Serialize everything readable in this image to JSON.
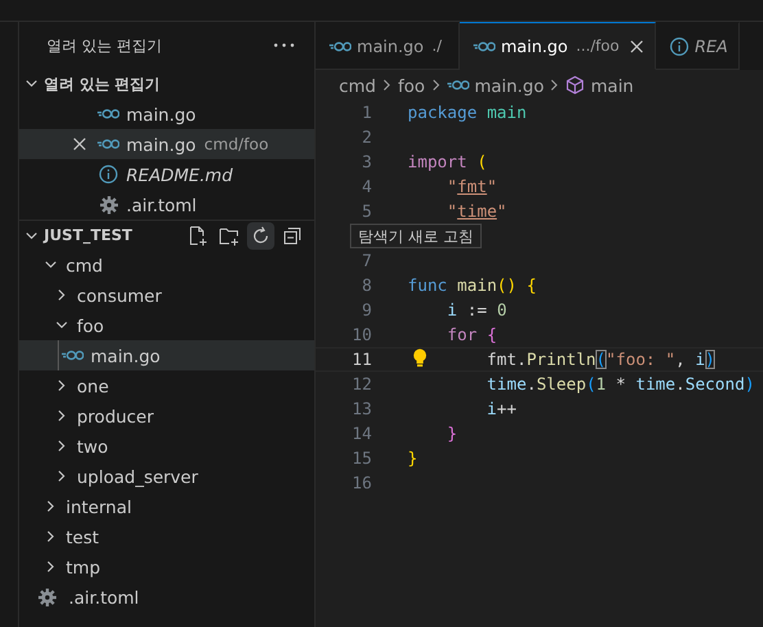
{
  "sidebar": {
    "title": "열려 있는 편집기"
  },
  "open_editors": {
    "title": "열려 있는 편집기",
    "expanded": true,
    "items": [
      {
        "name": "main.go",
        "kind": "go",
        "preview": false,
        "selected": false,
        "close": false
      },
      {
        "name": "main.go",
        "description": "cmd/foo",
        "kind": "go",
        "preview": false,
        "selected": true,
        "close": true
      },
      {
        "name": "README.md",
        "kind": "info",
        "preview": true,
        "selected": false,
        "close": false
      },
      {
        "name": ".air.toml",
        "kind": "gear",
        "preview": false,
        "selected": false,
        "close": false
      }
    ]
  },
  "explorer": {
    "title": "JUST_TEST",
    "expanded": true,
    "tooltip": "탐색기 새로 고침",
    "actions": [
      {
        "kind": "new-file",
        "hovered": false
      },
      {
        "kind": "new-folder",
        "hovered": false
      },
      {
        "kind": "refresh",
        "hovered": true
      },
      {
        "kind": "collapse",
        "hovered": false
      }
    ],
    "items": [
      {
        "name": "cmd",
        "kind": "folder",
        "expanded": true,
        "selected": false,
        "children": [
          {
            "name": "consumer",
            "kind": "folder",
            "expanded": false,
            "selected": false
          },
          {
            "name": "foo",
            "kind": "folder",
            "expanded": true,
            "selected": false,
            "children": [
              {
                "name": "main.go",
                "kind": "go",
                "selected": true
              }
            ]
          },
          {
            "name": "one",
            "kind": "folder",
            "expanded": false,
            "selected": false
          },
          {
            "name": "producer",
            "kind": "folder",
            "expanded": false,
            "selected": false
          },
          {
            "name": "two",
            "kind": "folder",
            "expanded": false,
            "selected": false
          },
          {
            "name": "upload_server",
            "kind": "folder",
            "expanded": false,
            "selected": false
          }
        ]
      },
      {
        "name": "internal",
        "kind": "folder",
        "expanded": false,
        "selected": false
      },
      {
        "name": "test",
        "kind": "folder",
        "expanded": false,
        "selected": false
      },
      {
        "name": "tmp",
        "kind": "folder",
        "expanded": false,
        "selected": false
      },
      {
        "name": ".air.toml",
        "kind": "gear",
        "selected": false
      }
    ]
  },
  "editor": {
    "tabs": [
      {
        "label": "main.go",
        "description": "./",
        "kind": "go",
        "selected": false,
        "preview": false,
        "close": false
      },
      {
        "label": "main.go",
        "description": ".../foo",
        "kind": "go",
        "selected": true,
        "preview": false,
        "close": true
      },
      {
        "label": "REA",
        "kind": "info",
        "selected": false,
        "preview": true,
        "close": false
      }
    ],
    "breadcrumbs": [
      {
        "label": "cmd",
        "kind": "folder"
      },
      {
        "label": "foo",
        "kind": "folder"
      },
      {
        "label": "main.go",
        "kind": "go"
      },
      {
        "label": "main",
        "kind": "symbol"
      }
    ],
    "lines": [
      {
        "number": "1",
        "current": false,
        "lightbulb": false,
        "tokens": [
          {
            "kind": "kw",
            "text": "package"
          },
          {
            "kind": "pkg",
            "text": " main"
          }
        ]
      },
      {
        "number": "2",
        "current": false,
        "lightbulb": false
      },
      {
        "number": "3",
        "current": false,
        "lightbulb": false,
        "tokens": [
          {
            "kind": "ctrl",
            "text": "import"
          },
          {
            "kind": "b1",
            "text": " ("
          }
        ]
      },
      {
        "number": "4",
        "current": false,
        "lightbulb": false,
        "tokens": [
          {
            "kind": "str",
            "text": "    \""
          },
          {
            "kind": "link",
            "text": "fmt"
          },
          {
            "kind": "str",
            "text": "\""
          }
        ]
      },
      {
        "number": "5",
        "current": false,
        "lightbulb": false,
        "tokens": [
          {
            "kind": "str",
            "text": "    \""
          },
          {
            "kind": "link",
            "text": "time"
          },
          {
            "kind": "str",
            "text": "\""
          }
        ]
      },
      {
        "number": "7",
        "current": false,
        "lightbulb": false
      },
      {
        "number": "8",
        "current": false,
        "lightbulb": false,
        "tokens": [
          {
            "kind": "kw",
            "text": "func"
          },
          {
            "kind": "fn",
            "text": " main"
          },
          {
            "kind": "b1",
            "text": "() {"
          }
        ]
      },
      {
        "number": "9",
        "current": false,
        "lightbulb": false,
        "tokens": [
          {
            "kind": "var",
            "text": "    i"
          },
          {
            "kind": "plain",
            "text": " := "
          },
          {
            "kind": "num",
            "text": "0"
          }
        ]
      },
      {
        "number": "10",
        "current": false,
        "lightbulb": false,
        "tokens": [
          {
            "kind": "ctrl",
            "text": "    for"
          },
          {
            "kind": "b2",
            "text": " {"
          }
        ]
      },
      {
        "number": "11",
        "current": true,
        "lightbulb": true,
        "tokens": [
          {
            "kind": "plain",
            "text": "        fmt."
          },
          {
            "kind": "fn",
            "text": "Println"
          },
          {
            "kind": "b3m",
            "text": "("
          },
          {
            "kind": "str",
            "text": "\"foo: \""
          },
          {
            "kind": "plain",
            "text": ","
          },
          {
            "kind": "var",
            "text": " i"
          },
          {
            "kind": "b3m",
            "text": ")"
          }
        ]
      },
      {
        "number": "12",
        "current": false,
        "lightbulb": false,
        "tokens": [
          {
            "kind": "var",
            "text": "        time"
          },
          {
            "kind": "plain",
            "text": "."
          },
          {
            "kind": "fn",
            "text": "Sleep"
          },
          {
            "kind": "b3",
            "text": "("
          },
          {
            "kind": "num",
            "text": "1"
          },
          {
            "kind": "plain",
            "text": " * "
          },
          {
            "kind": "var",
            "text": "time"
          },
          {
            "kind": "plain",
            "text": "."
          },
          {
            "kind": "var",
            "text": "Second"
          },
          {
            "kind": "b3",
            "text": ")"
          }
        ]
      },
      {
        "number": "13",
        "current": false,
        "lightbulb": false,
        "tokens": [
          {
            "kind": "var",
            "text": "        i"
          },
          {
            "kind": "plain",
            "text": "++"
          }
        ]
      },
      {
        "number": "14",
        "current": false,
        "lightbulb": false,
        "tokens": [
          {
            "kind": "b2",
            "text": "    }"
          }
        ]
      },
      {
        "number": "15",
        "current": false,
        "lightbulb": false,
        "tokens": [
          {
            "kind": "b1",
            "text": "}"
          }
        ]
      },
      {
        "number": "16",
        "current": false,
        "lightbulb": false
      }
    ]
  }
}
